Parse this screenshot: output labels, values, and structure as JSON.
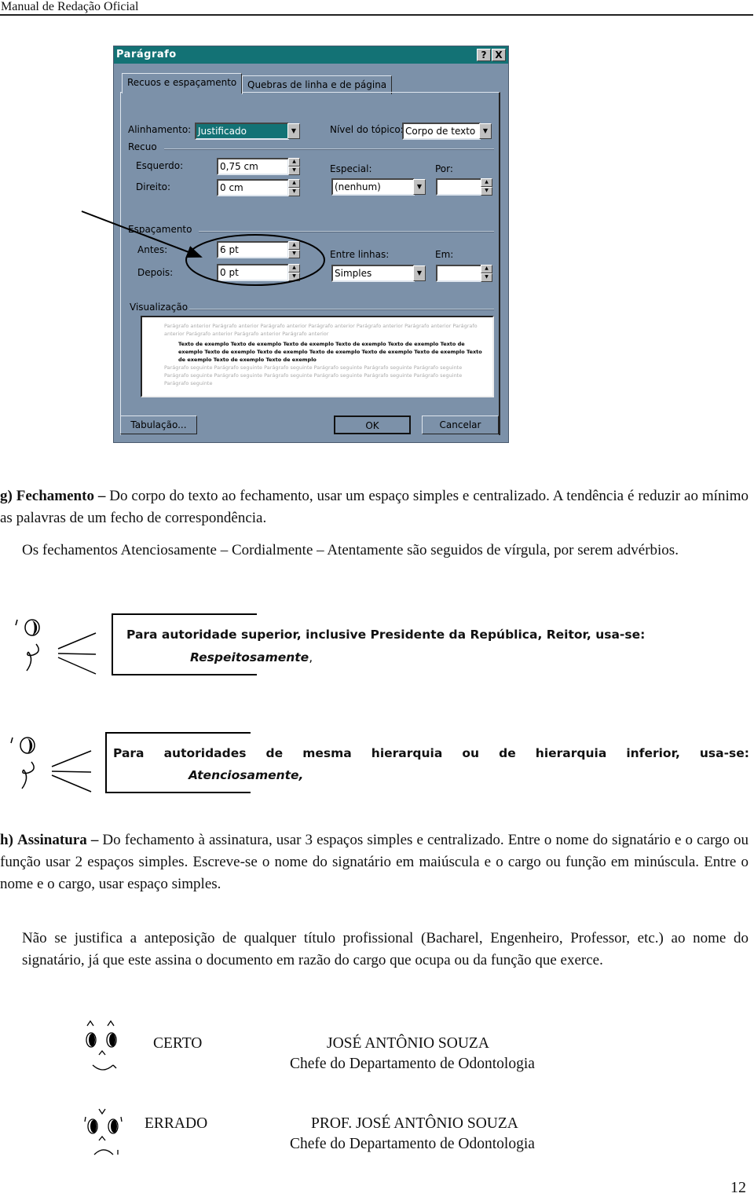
{
  "header": {
    "title": "Manual de Redação Oficial"
  },
  "dialog": {
    "title": "Parágrafo",
    "help_button": "?",
    "close_button": "X",
    "tabs": [
      {
        "label": "Recuos e espaçamento",
        "active": true
      },
      {
        "label": "Quebras de linha e de página",
        "active": false
      }
    ],
    "alinhamento": {
      "label": "Alinhamento:",
      "value": "Justificado"
    },
    "nivel_topico": {
      "label": "Nível do tópico:",
      "value": "Corpo de texto"
    },
    "recuo": {
      "group_label": "Recuo",
      "esquerdo": {
        "label": "Esquerdo:",
        "value": "0,75 cm"
      },
      "direito": {
        "label": "Direito:",
        "value": "0 cm"
      },
      "especial": {
        "label": "Especial:",
        "value": "(nenhum)"
      },
      "por": {
        "label": "Por:",
        "value": ""
      }
    },
    "espacamento": {
      "group_label": "Espaçamento",
      "antes": {
        "label": "Antes:",
        "value": "6 pt"
      },
      "depois": {
        "label": "Depois:",
        "value": "0 pt"
      },
      "entre_linhas": {
        "label": "Entre linhas:",
        "value": "Simples"
      },
      "em": {
        "label": "Em:",
        "value": ""
      }
    },
    "visualizacao": {
      "group_label": "Visualização",
      "prev_text": "Parágrafo anterior Parágrafo anterior Parágrafo anterior Parágrafo anterior Parágrafo anterior Parágrafo anterior Parágrafo anterior Parágrafo anterior Parágrafo anterior Parágrafo anterior",
      "sample_text": "Texto de exemplo Texto de exemplo Texto de exemplo Texto de exemplo Texto de exemplo Texto de exemplo Texto de exemplo Texto de exemplo Texto de exemplo Texto de exemplo Texto de exemplo Texto de exemplo Texto de exemplo Texto de exemplo",
      "next_text": "Parágrafo seguinte Parágrafo seguinte Parágrafo seguinte Parágrafo seguinte Parágrafo seguinte Parágrafo seguinte Parágrafo seguinte Parágrafo seguinte Parágrafo seguinte Parágrafo seguinte Parágrafo seguinte Parágrafo seguinte Parágrafo seguinte"
    },
    "buttons": {
      "tabulacao": "Tabulação...",
      "ok": "OK",
      "cancelar": "Cancelar"
    }
  },
  "section_g": {
    "marker": "g)",
    "title": "Fechamento",
    "dash": "–",
    "text": "Do corpo do texto ao fechamento, usar um espaço simples e  centralizado. A tendência é reduzir ao mínimo as palavras de um fecho de correspondência.",
    "note": "Os fechamentos Atenciosamente – Cordialmente – Atentamente são seguidos de vírgula, por serem advérbios."
  },
  "callouts": [
    {
      "text": "Para autoridade superior, inclusive Presidente da República, Reitor, usa-se:",
      "closing": "Respeitosamente",
      "closing_suffix": ","
    },
    {
      "text": "Para autoridades de mesma hierarquia ou de hierarquia inferior, usa-se:",
      "closing": "Atenciosamente,",
      "closing_suffix": ""
    }
  ],
  "section_h": {
    "marker": "h)",
    "title": "Assinatura",
    "dash": "–",
    "text": "Do fechamento à assinatura, usar 3 espaços simples e centralizado. Entre o nome do signatário e o cargo ou função usar 2 espaços simples. Escreve-se o nome do signatário em maiúscula e o cargo ou função em minúscula. Entre o nome e o cargo, usar espaço simples.",
    "note": "Não se justifica a anteposição de qualquer título profissional (Bacharel, Engenheiro, Professor, etc.) ao  nome do signatário, já que este assina o documento em razão do cargo que ocupa ou da função que exerce."
  },
  "examples": [
    {
      "verdict": "CERTO",
      "face": "happy-face-icon",
      "name": "JOSÉ ANTÔNIO SOUZA",
      "role": "Chefe do Departamento de Odontologia"
    },
    {
      "verdict": "ERRADO",
      "face": "sad-face-icon",
      "name": "PROF. JOSÉ ANTÔNIO SOUZA",
      "role": "Chefe do Departamento de Odontologia"
    }
  ],
  "footer": {
    "page_number": "12"
  }
}
